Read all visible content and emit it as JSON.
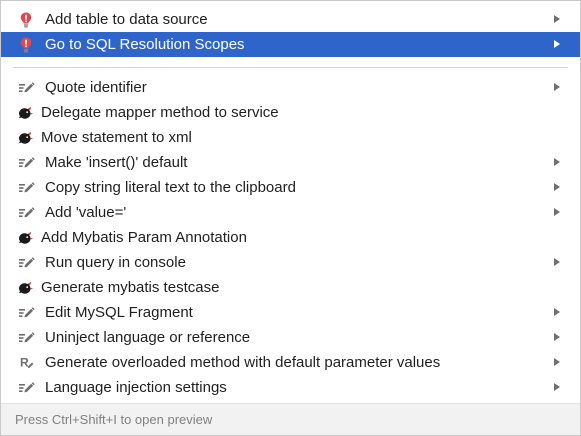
{
  "menu": {
    "top_items": [
      {
        "label": "Add table to data source",
        "icon": "error-bulb-icon",
        "has_submenu": true,
        "selected": false
      },
      {
        "label": "Go to SQL Resolution Scopes",
        "icon": "error-bulb-icon",
        "has_submenu": true,
        "selected": true
      }
    ],
    "items": [
      {
        "label": "Quote identifier",
        "icon": "intention-pencil-icon",
        "has_submenu": true
      },
      {
        "label": "Delegate mapper method to service",
        "icon": "mybatis-bird-icon",
        "has_submenu": false
      },
      {
        "label": "Move statement to xml",
        "icon": "mybatis-bird-icon",
        "has_submenu": false
      },
      {
        "label": "Make 'insert()' default",
        "icon": "intention-pencil-icon",
        "has_submenu": true
      },
      {
        "label": "Copy string literal text to the clipboard",
        "icon": "intention-pencil-icon",
        "has_submenu": true
      },
      {
        "label": "Add 'value='",
        "icon": "intention-pencil-icon",
        "has_submenu": true
      },
      {
        "label": "Add Mybatis Param Annotation",
        "icon": "mybatis-bird-icon",
        "has_submenu": false
      },
      {
        "label": "Run query in console",
        "icon": "intention-pencil-icon",
        "has_submenu": true
      },
      {
        "label": "Generate mybatis testcase",
        "icon": "mybatis-bird-icon",
        "has_submenu": false
      },
      {
        "label": "Edit MySQL Fragment",
        "icon": "intention-pencil-icon",
        "has_submenu": true
      },
      {
        "label": "Uninject language or reference",
        "icon": "intention-pencil-icon",
        "has_submenu": true
      },
      {
        "label": "Generate overloaded method with default parameter values",
        "icon": "refactoring-icon",
        "has_submenu": true
      },
      {
        "label": "Language injection settings",
        "icon": "intention-pencil-icon",
        "has_submenu": true
      }
    ]
  },
  "footer": {
    "hint": "Press Ctrl+Shift+I to open preview"
  },
  "colors": {
    "selection": "#2f65ca",
    "error_bulb": "#e0474f",
    "bird": "#1a1a1a",
    "bird_accent": "#d23a2e",
    "pencil": "#6e6e6e"
  }
}
